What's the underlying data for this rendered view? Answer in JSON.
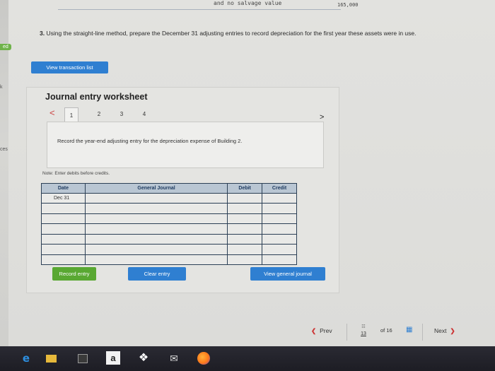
{
  "top": {
    "label": "and no salvage value",
    "value": "165,000"
  },
  "left_tabs": [
    "ed",
    "k",
    "ces"
  ],
  "instruction": {
    "number": "3.",
    "text": "Using the straight-line method, prepare the December 31 adjusting entries to record depreciation for the first year these assets were in use."
  },
  "view_transaction_list": "View transaction list",
  "worksheet": {
    "title": "Journal entry worksheet",
    "prev_arrow": "<",
    "next_arrow": ">",
    "tabs": [
      "1",
      "2",
      "3",
      "4"
    ],
    "description": "Record the year-end adjusting entry for the depreciation expense of Building 2.",
    "note": "Note: Enter debits before credits.",
    "table": {
      "headers": [
        "Date",
        "General Journal",
        "Debit",
        "Credit"
      ],
      "first_date": "Dec 31"
    },
    "record_entry": "Record entry",
    "clear_entry": "Clear entry",
    "view_general_journal": "View general journal"
  },
  "pager": {
    "prev": "Prev",
    "current": "13",
    "of_total": "of 16",
    "next": "Next"
  },
  "colors": {
    "blue_button": "#2f7fd1",
    "green_button": "#59a832",
    "table_header": "#b9c6d3",
    "taskbar": "#1d1d24"
  },
  "taskbar_icons": [
    "edge-icon",
    "file-explorer-icon",
    "store-icon",
    "amazon-icon",
    "dropbox-icon",
    "mail-icon",
    "firefox-icon"
  ]
}
